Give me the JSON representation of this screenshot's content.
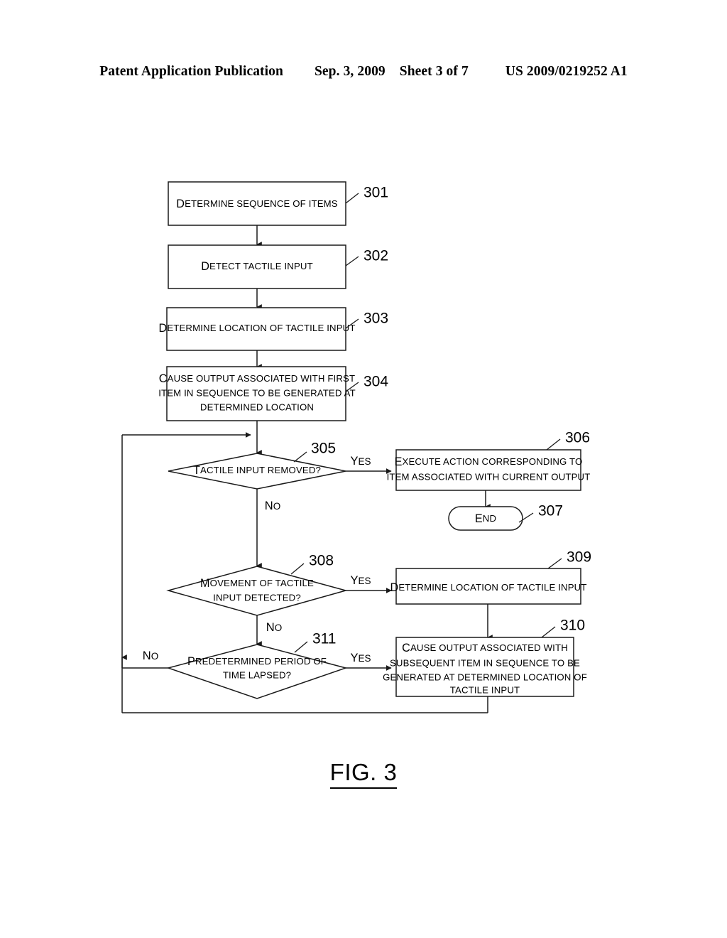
{
  "header": {
    "publication": "Patent Application Publication",
    "date": "Sep. 3, 2009",
    "sheet": "Sheet 3 of 7",
    "patent_number": "US 2009/0219252 A1"
  },
  "figure": {
    "caption": "FIG. 3"
  },
  "flowchart": {
    "nodes": [
      {
        "id": "301",
        "ref": "301",
        "type": "process",
        "lines": [
          "Determine sequence of items"
        ]
      },
      {
        "id": "302",
        "ref": "302",
        "type": "process",
        "lines": [
          "Detect tactile input"
        ]
      },
      {
        "id": "303",
        "ref": "303",
        "type": "process",
        "lines": [
          "Determine location of tactile input"
        ]
      },
      {
        "id": "304",
        "ref": "304",
        "type": "process",
        "lines": [
          "Cause output associated with first",
          "item in sequence to be generated at",
          "determined location"
        ]
      },
      {
        "id": "305",
        "ref": "305",
        "type": "decision",
        "lines": [
          "Tactile input removed?"
        ]
      },
      {
        "id": "306",
        "ref": "306",
        "type": "process",
        "lines": [
          "Execute action corresponding to",
          "item associated with current output"
        ]
      },
      {
        "id": "307",
        "ref": "307",
        "type": "terminator",
        "lines": [
          "End"
        ]
      },
      {
        "id": "308",
        "ref": "308",
        "type": "decision",
        "lines": [
          "Movement of tactile",
          "input detected?"
        ]
      },
      {
        "id": "309",
        "ref": "309",
        "type": "process",
        "lines": [
          "Determine location of tactile input"
        ]
      },
      {
        "id": "310",
        "ref": "310",
        "type": "process",
        "lines": [
          "Cause output associated with",
          "subsequent item in sequence to be",
          "generated at determined location of",
          "tactile input"
        ]
      },
      {
        "id": "311",
        "ref": "311",
        "type": "decision",
        "lines": [
          "Predetermined period of",
          "time lapsed?"
        ]
      }
    ],
    "branch_labels": {
      "yes_305": "Yes",
      "no_305": "No",
      "yes_308": "Yes",
      "no_308": "No",
      "yes_311": "Yes",
      "no_311": "No"
    }
  }
}
